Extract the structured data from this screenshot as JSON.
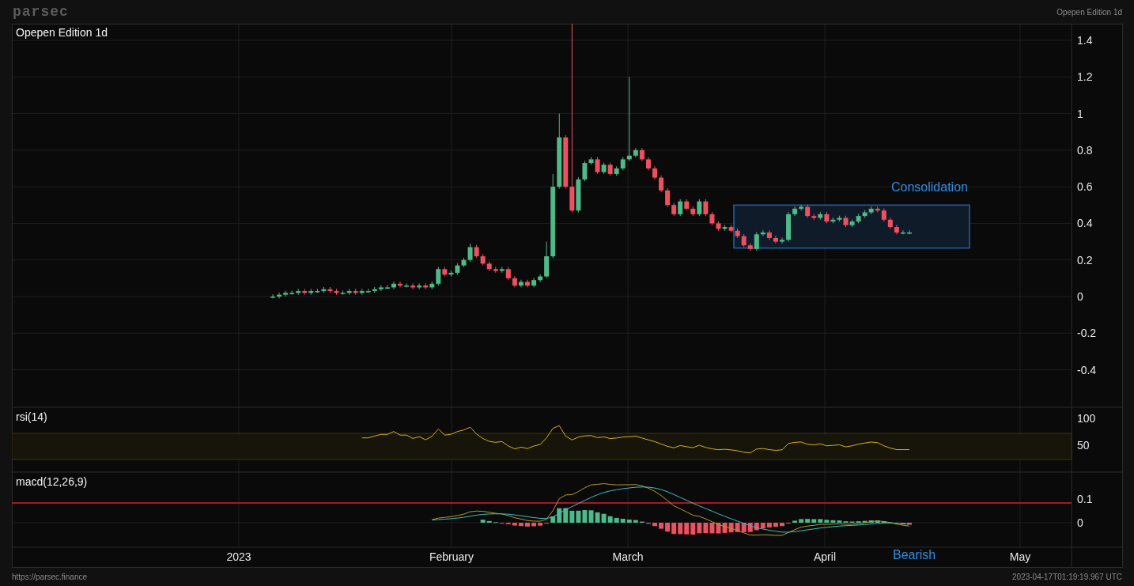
{
  "header": {
    "brand": "parsec",
    "title": "Opepen Edition 1d"
  },
  "price_pane": {
    "title": "Opepen Edition 1d",
    "price_ticks": [
      "1.4",
      "1.2",
      "1",
      "0.8",
      "0.6",
      "0.4",
      "0.2",
      "0",
      "-0.2",
      "-0.4"
    ],
    "annotation": "Consolidation"
  },
  "rsi_pane": {
    "title": "rsi(14)",
    "ticks": [
      "100",
      "50"
    ]
  },
  "macd_pane": {
    "title": "macd(12,26,9)",
    "ticks": [
      "0.1",
      "0"
    ],
    "annotation": "Bearish"
  },
  "time_axis": [
    "2023",
    "February",
    "March",
    "April",
    "May"
  ],
  "footer": {
    "url": "https://parsec.finance",
    "timestamp": "2023-04-17T01:19:19.967 UTC"
  }
}
